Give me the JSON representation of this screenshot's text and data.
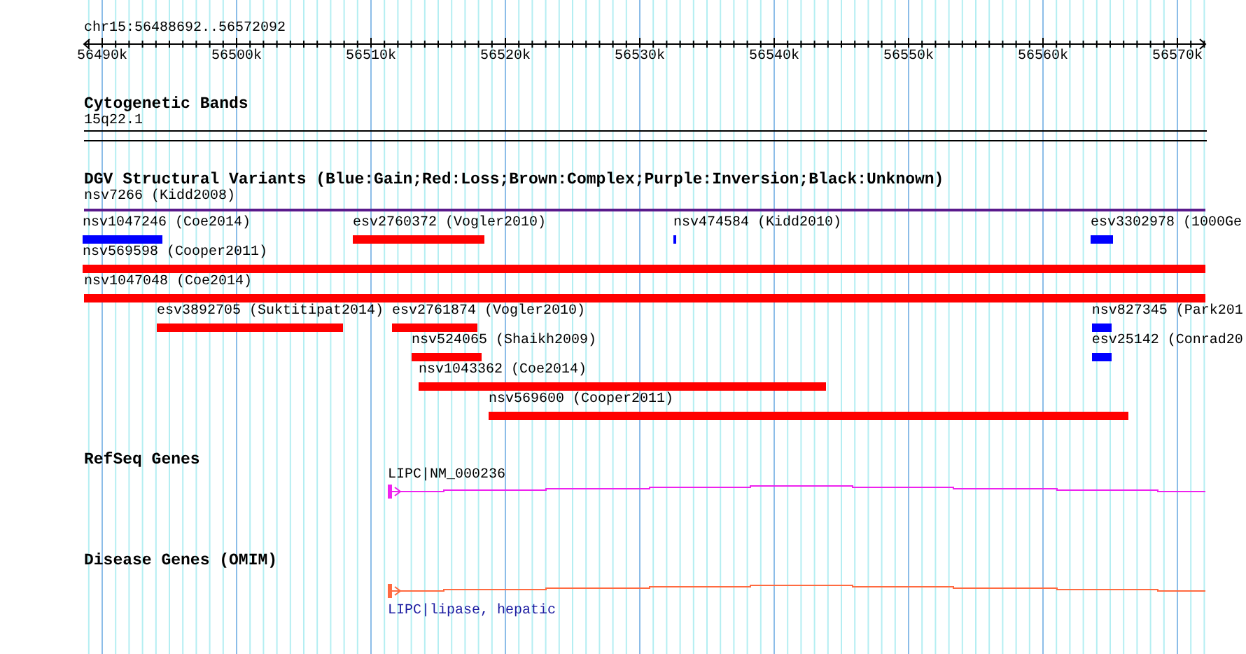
{
  "ruler": {
    "location": "chr15:56488692..56572092",
    "tick_labels": [
      "56490k",
      "56500k",
      "56510k",
      "56520k",
      "56530k",
      "56540k",
      "56550k",
      "56560k",
      "56570k"
    ]
  },
  "tracks": [
    {
      "kind": "cytoband",
      "title": "Cytogenetic Bands",
      "band": "15q22.1"
    },
    {
      "kind": "variants",
      "title": "DGV Structural Variants (Blue:Gain;Red:Loss;Brown:Complex;Purple:Inversion;Black:Unknown)",
      "features": [
        {
          "label": "nsv7266 (Kidd2008)",
          "color": "#5a1a8c"
        },
        {
          "label": "nsv1047246 (Coe2014)",
          "color": "#0000ff"
        },
        {
          "label": "esv2760372 (Vogler2010)",
          "color": "#ff0000"
        },
        {
          "label": "nsv474584 (Kidd2010)",
          "color": "#0000ff"
        },
        {
          "label": "esv3302978 (1000Ge",
          "color": "#0000ff"
        },
        {
          "label": "nsv569598 (Cooper2011)",
          "color": "#ff0000"
        },
        {
          "label": "nsv1047048 (Coe2014)",
          "color": "#ff0000"
        },
        {
          "label": "esv3892705 (Suktitipat2014)",
          "color": "#ff0000"
        },
        {
          "label": "esv2761874 (Vogler2010)",
          "color": "#ff0000"
        },
        {
          "label": "nsv827345 (Park201",
          "color": "#0000ff"
        },
        {
          "label": "nsv524065 (Shaikh2009)",
          "color": "#ff0000"
        },
        {
          "label": "esv25142 (Conrad20",
          "color": "#0000ff"
        },
        {
          "label": "nsv1043362 (Coe2014)",
          "color": "#ff0000"
        },
        {
          "label": "nsv569600 (Cooper2011)",
          "color": "#ff0000"
        }
      ]
    },
    {
      "kind": "gene",
      "title": "RefSeq Genes",
      "gene_label": "LIPC|NM_000236",
      "color": "#ee22ee"
    },
    {
      "kind": "disease",
      "title": "Disease Genes (OMIM)",
      "gene_label": "LIPC|lipase, hepatic",
      "color": "#ff6a40"
    }
  ]
}
